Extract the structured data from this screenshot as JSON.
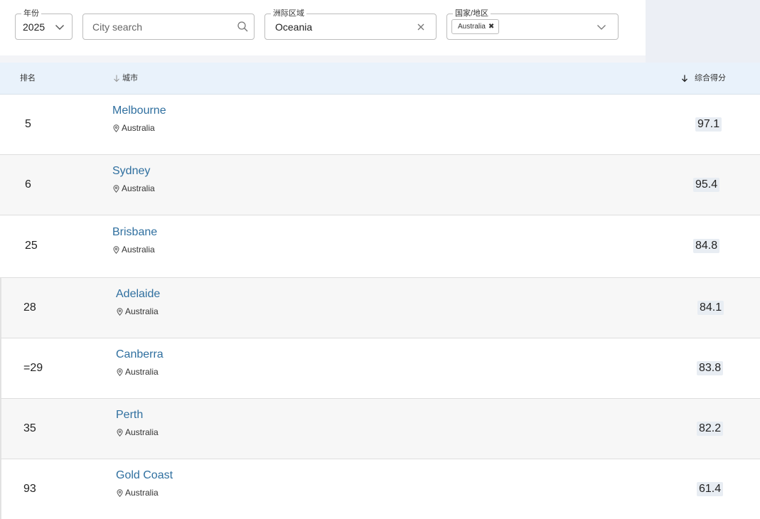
{
  "filters": {
    "year": {
      "legend": "年份",
      "value": "2025"
    },
    "city_search": {
      "placeholder": "City search"
    },
    "region": {
      "legend": "洲际区域",
      "value": "Oceania"
    },
    "country": {
      "legend": "国家/地区",
      "chip": "Australia",
      "chip_remove": "✖"
    }
  },
  "table": {
    "columns": {
      "rank": "排名",
      "city": "城市",
      "score": "综合得分"
    },
    "rows": [
      {
        "rank": "5",
        "city": "Melbourne",
        "country": "Australia",
        "score": "97.1"
      },
      {
        "rank": "6",
        "city": "Sydney",
        "country": "Australia",
        "score": "95.4"
      },
      {
        "rank": "25",
        "city": "Brisbane",
        "country": "Australia",
        "score": "84.8"
      },
      {
        "rank": "28",
        "city": "Adelaide",
        "country": "Australia",
        "score": "84.1"
      },
      {
        "rank": "=29",
        "city": "Canberra",
        "country": "Australia",
        "score": "83.8"
      },
      {
        "rank": "35",
        "city": "Perth",
        "country": "Australia",
        "score": "82.2"
      },
      {
        "rank": "93",
        "city": "Gold Coast",
        "country": "Australia",
        "score": "61.4"
      }
    ]
  },
  "icons": {
    "dropdown": "chevron-down-icon",
    "search": "search-icon",
    "clear": "close-icon",
    "sort": "arrow-down-icon",
    "location": "location-pin-icon"
  },
  "colors": {
    "link": "#2f6f9f",
    "header_bg": "#e9f2fb",
    "score_bg": "#e8edf3"
  }
}
